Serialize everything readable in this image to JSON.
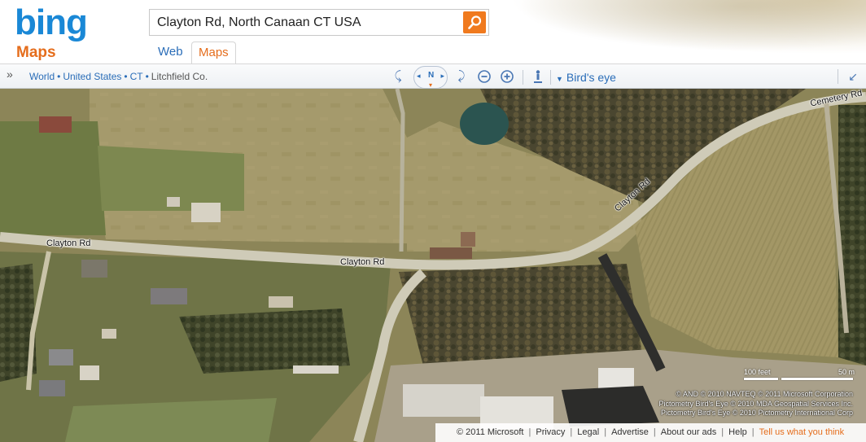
{
  "header": {
    "logo_text": "bing",
    "logo_sub": "Maps",
    "search_value": "Clayton Rd, North Canaan CT USA",
    "tabs": [
      {
        "label": "Web"
      },
      {
        "label": "Maps"
      }
    ]
  },
  "toolbar": {
    "breadcrumb": [
      "World",
      "United States",
      "CT",
      "Litchfield Co."
    ],
    "compass_label": "N",
    "view_mode": "Bird's eye"
  },
  "map": {
    "road_labels": [
      "Cemetery Rd",
      "Clayton Rd",
      "Clayton Rd",
      "Clayton Rd"
    ],
    "scale": {
      "feet": "100 feet",
      "meters": "50 m"
    },
    "copyright": [
      "© AND  © 2010 NAVTEQ  © 2011 Microsoft Corporation",
      "Pictometry Bird's Eye © 2010 MDA Geospatial Services Inc.",
      "Pictometry Bird's Eye © 2010 Pictometry International Corp"
    ]
  },
  "footer": {
    "copyright": "© 2011 Microsoft",
    "links": [
      "Privacy",
      "Legal",
      "Advertise",
      "About our ads",
      "Help"
    ],
    "feedback": "Tell us what you think"
  },
  "colors": {
    "brand_blue": "#1a88d6",
    "brand_orange": "#e56d1c",
    "link_blue": "#2a6db8"
  }
}
